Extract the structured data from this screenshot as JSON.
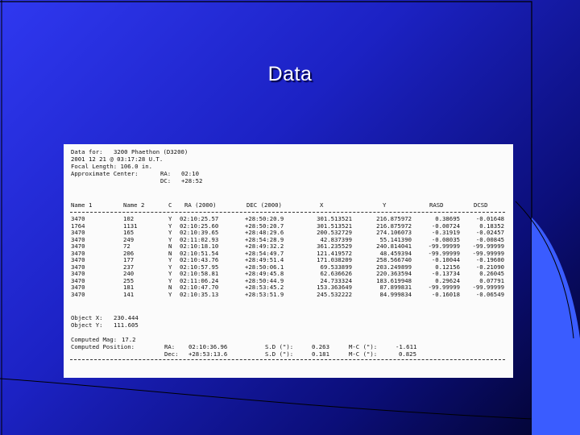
{
  "slide": {
    "title": "Data"
  },
  "report": {
    "header": {
      "data_for_label": "Data for:",
      "data_for_value": "3200 Phaethon (D3200)",
      "date": "2001 12 21 @ 03:17:28 U.T.",
      "focal_length": "Focal Length: 106.0 in.",
      "approx_center_label": "Approximate Center:",
      "ra_label": "RA:",
      "ra_value": "02:10",
      "dc_label": "DC:",
      "dc_value": "+28:52"
    },
    "columns": [
      "Name 1",
      "Name 2",
      "C",
      "RA (2000)",
      "DEC (2000)",
      "X",
      "Y",
      "RASD",
      "DCSD"
    ],
    "rows": [
      {
        "name1": "3470",
        "name2": "102",
        "c": "Y",
        "ra": "02:10:25.57",
        "dec": "+28:50:20.9",
        "x": "301.513521",
        "y": "216.875972",
        "rasd": "0.38695",
        "dcsd": "-0.01648"
      },
      {
        "name1": "1764",
        "name2": "1131",
        "c": "Y",
        "ra": "02:10:25.60",
        "dec": "+28:50:20.7",
        "x": "301.513521",
        "y": "216.875972",
        "rasd": "-0.00724",
        "dcsd": "0.18352"
      },
      {
        "name1": "3470",
        "name2": "165",
        "c": "Y",
        "ra": "02:10:39.65",
        "dec": "+28:48:29.6",
        "x": "200.532729",
        "y": "274.106073",
        "rasd": "-0.31919",
        "dcsd": "-0.02457"
      },
      {
        "name1": "3470",
        "name2": "249",
        "c": "Y",
        "ra": "02:11:02.93",
        "dec": "+28:54:28.9",
        "x": "42.837399",
        "y": "55.141390",
        "rasd": "-0.08035",
        "dcsd": "-0.00845"
      },
      {
        "name1": "3470",
        "name2": "72",
        "c": "N",
        "ra": "02:10:18.10",
        "dec": "+28:49:32.2",
        "x": "361.235529",
        "y": "240.814041",
        "rasd": "-99.99999",
        "dcsd": "-99.99999"
      },
      {
        "name1": "3470",
        "name2": "206",
        "c": "N",
        "ra": "02:10:51.54",
        "dec": "+28:54:49.7",
        "x": "121.419572",
        "y": "48.459394",
        "rasd": "-99.99999",
        "dcsd": "-99.99999"
      },
      {
        "name1": "3470",
        "name2": "177",
        "c": "Y",
        "ra": "02:10:43.76",
        "dec": "+28:49:51.4",
        "x": "171.038209",
        "y": "258.566740",
        "rasd": "-0.10044",
        "dcsd": "-0.19600"
      },
      {
        "name1": "3470",
        "name2": "237",
        "c": "Y",
        "ra": "02:10:57.95",
        "dec": "+28:50:06.1",
        "x": "69.533899",
        "y": "203.249899",
        "rasd": "0.12156",
        "dcsd": "-0.21090"
      },
      {
        "name1": "3470",
        "name2": "240",
        "c": "Y",
        "ra": "02:10:58.81",
        "dec": "+28:49:45.8",
        "x": "62.636626",
        "y": "220.363594",
        "rasd": "-0.13734",
        "dcsd": "0.26045"
      },
      {
        "name1": "3470",
        "name2": "255",
        "c": "Y",
        "ra": "02:11:06.24",
        "dec": "+28:50:44.9",
        "x": "24.733324",
        "y": "183.619948",
        "rasd": "0.29624",
        "dcsd": "0.07791"
      },
      {
        "name1": "3470",
        "name2": "181",
        "c": "N",
        "ra": "02:10:47.70",
        "dec": "+28:53:45.2",
        "x": "153.363649",
        "y": "87.899831",
        "rasd": "-99.99999",
        "dcsd": "-99.99999"
      },
      {
        "name1": "3470",
        "name2": "141",
        "c": "Y",
        "ra": "02:10:35.13",
        "dec": "+28:53:51.9",
        "x": "245.532222",
        "y": "84.999834",
        "rasd": "-0.16018",
        "dcsd": "-0.06549"
      }
    ],
    "object": {
      "x_label": "Object X:",
      "x_value": "230.444",
      "y_label": "Object Y:",
      "y_value": "111.605"
    },
    "computed": {
      "mag_label": "Computed Mag:",
      "mag_value": "17.2",
      "position_label": "Computed Position:",
      "ra_label": "RA:",
      "ra_value": "02:10:36.96",
      "dec_label": "Dec:",
      "dec_value": "+28:53:13.6",
      "sd_label": "S.D (\"):",
      "sd_ra": "0.263",
      "sd_dec": "0.181",
      "omc_label": "M-C (\"):",
      "omc_ra": "-1.611",
      "omc_dec": "0.825"
    }
  }
}
